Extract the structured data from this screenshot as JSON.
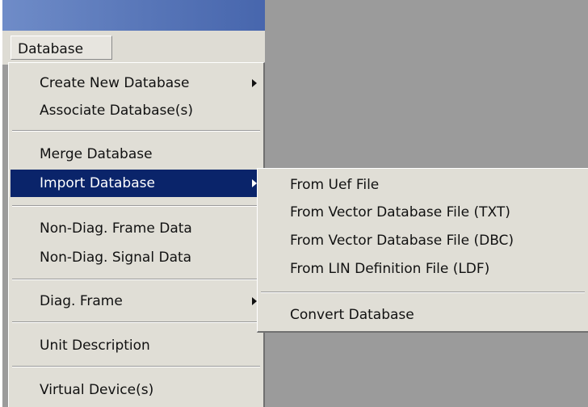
{
  "menubar": {
    "menu_title": "Database"
  },
  "menu": {
    "items": [
      {
        "label": "Create New Database",
        "has_submenu": true
      },
      {
        "label": "Associate Database(s)",
        "has_submenu": false
      },
      {
        "label": "Merge Database",
        "has_submenu": false
      },
      {
        "label": "Import Database",
        "has_submenu": true,
        "highlighted": true
      },
      {
        "label": "Non-Diag. Frame Data",
        "has_submenu": false
      },
      {
        "label": "Non-Diag. Signal Data",
        "has_submenu": false
      },
      {
        "label": "Diag. Frame",
        "has_submenu": true
      },
      {
        "label": "Unit Description",
        "has_submenu": false
      },
      {
        "label": "Virtual Device(s)",
        "has_submenu": false
      }
    ]
  },
  "submenu": {
    "items": [
      {
        "label": "From Uef File"
      },
      {
        "label": "From Vector Database File (TXT)"
      },
      {
        "label": "From Vector Database File (DBC)"
      },
      {
        "label": "From LIN Definition File (LDF)"
      },
      {
        "label": "Convert  Database"
      }
    ]
  },
  "colors": {
    "highlight": "#0a246a",
    "menu_bg": "#e0ded6",
    "workspace": "#9b9b9b",
    "titlebar": "#5876b8"
  }
}
